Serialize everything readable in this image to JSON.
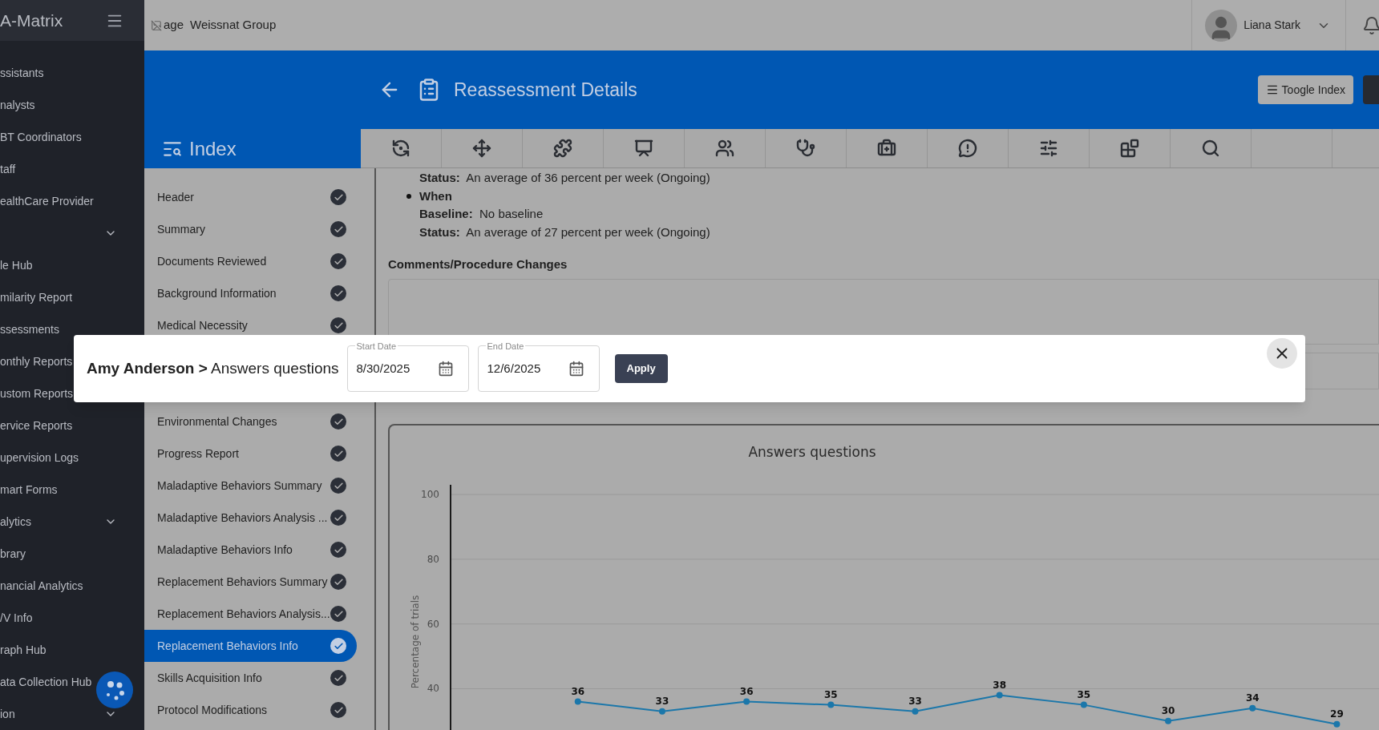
{
  "app": {
    "logo": "A-Matrix"
  },
  "sidebar": {
    "items": [
      {
        "label": "ssistants",
        "expandable": false
      },
      {
        "label": "nalysts",
        "expandable": false
      },
      {
        "label": "BT Coordinators",
        "expandable": false
      },
      {
        "label": "taff",
        "expandable": false
      },
      {
        "label": "ealthCare Provider",
        "expandable": false
      },
      {
        "expandable": true
      },
      {
        "label": "le Hub",
        "expandable": false
      },
      {
        "label": "milarity Report",
        "expandable": false
      },
      {
        "label": "ssessments",
        "expandable": false
      },
      {
        "label": "onthly Reports",
        "expandable": false
      },
      {
        "label": "ustom Reports",
        "expandable": false
      },
      {
        "label": "ervice Reports",
        "expandable": false
      },
      {
        "label": "upervision Logs",
        "expandable": false
      },
      {
        "label": "mart Forms",
        "expandable": false
      },
      {
        "label": "alytics",
        "expandable": true
      },
      {
        "label": "brary",
        "expandable": false
      },
      {
        "label": "nancial Analytics",
        "expandable": false
      },
      {
        "label": "/V Info",
        "expandable": false
      },
      {
        "label": "raph Hub",
        "expandable": false
      },
      {
        "label": "ata Collection Hub",
        "expandable": false
      },
      {
        "label": "ion",
        "expandable": true
      }
    ]
  },
  "header": {
    "image_alt": "age",
    "organization": "Weissnat Group",
    "user": "Liana Stark"
  },
  "page": {
    "title": "Reassessment Details",
    "toggle_button": "Toogle Index"
  },
  "index": {
    "title": "Index",
    "items": [
      {
        "label": "Header",
        "done": true,
        "selected": false
      },
      {
        "label": "Summary",
        "done": true,
        "selected": false
      },
      {
        "label": "Documents Reviewed",
        "done": true,
        "selected": false
      },
      {
        "label": "Background Information",
        "done": true,
        "selected": false
      },
      {
        "label": "Medical Necessity",
        "done": true,
        "selected": false
      },
      {
        "label": "Environmental Changes",
        "done": true,
        "selected": false
      },
      {
        "label": "Progress Report",
        "done": true,
        "selected": false
      },
      {
        "label": "Maladaptive Behaviors Summary",
        "done": true,
        "selected": false
      },
      {
        "label": "Maladaptive Behaviors Analysis ...",
        "done": true,
        "selected": false
      },
      {
        "label": "Maladaptive Behaviors Info",
        "done": true,
        "selected": false
      },
      {
        "label": "Replacement Behaviors Summary",
        "done": true,
        "selected": false
      },
      {
        "label": "Replacement Behaviors Analysis...",
        "done": true,
        "selected": false
      },
      {
        "label": "Replacement Behaviors Info",
        "done": true,
        "selected": true
      },
      {
        "label": "Skills Acquisition Info",
        "done": true,
        "selected": false
      },
      {
        "label": "Protocol Modifications",
        "done": true,
        "selected": false
      }
    ]
  },
  "content": {
    "lines": [
      {
        "kind": "field",
        "text": "**Status:**  An average of 36 percent per week (Ongoing)"
      },
      {
        "kind": "bullet",
        "text": "When"
      },
      {
        "kind": "field",
        "text": "**Baseline:**  No baseline"
      },
      {
        "kind": "field",
        "text": "**Status:**  An average of 27 percent per week (Ongoing)"
      }
    ],
    "comments_heading": "Comments/Procedure Changes"
  },
  "chart_data": {
    "type": "line",
    "title": "Answers questions",
    "ylabel": "Percentage of trials",
    "yticks": [
      40,
      60,
      80,
      100
    ],
    "ylim": [
      25,
      103
    ],
    "data_labels": true,
    "grid": true,
    "marker": true,
    "values": [
      null,
      36,
      33,
      36,
      35,
      33,
      38,
      35,
      30,
      34,
      29
    ]
  },
  "dialog": {
    "title": "**Amy Anderson >** Answers questions",
    "start_date": {
      "label": "Start Date",
      "value": "8/30/2025"
    },
    "end_date": {
      "label": "End Date",
      "value": "12/6/2025"
    },
    "apply_button": "Apply"
  }
}
